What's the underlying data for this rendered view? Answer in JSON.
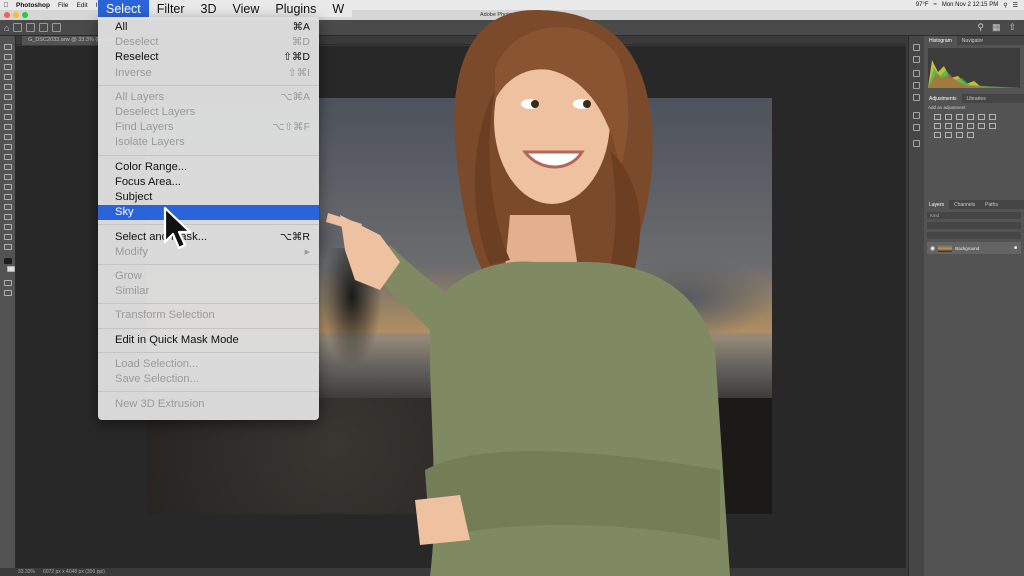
{
  "mac_menubar": {
    "app_name": "Photoshop",
    "items": [
      "File",
      "Edit",
      "Im"
    ],
    "big_items": [
      "Select",
      "Filter",
      "3D",
      "View",
      "Plugins",
      "W"
    ],
    "right_status": "97°F",
    "clock": "Mon Nov 2  12:15 PM"
  },
  "window": {
    "title": "Adobe Photoshop 2021"
  },
  "document": {
    "tab_label": "G_DSC2033.arw @ 33.3% (RGB/"
  },
  "status": {
    "zoom": "33.33%",
    "doc_info": "6072 px x 4048 px (300 ppi)"
  },
  "panels": {
    "top_tabs": [
      "Histogram",
      "Navigator"
    ],
    "adj_tabs": [
      "Adjustments",
      "Libraries"
    ],
    "adj_hint": "Add an adjustment",
    "layers_tabs": [
      "Layers",
      "Channels",
      "Paths"
    ],
    "layer_filter": "Kind",
    "layer_name": "Background"
  },
  "select_menu": {
    "title": "Select",
    "groups": [
      [
        {
          "label": "All",
          "shortcut": "⌘A",
          "disabled": false
        },
        {
          "label": "Deselect",
          "shortcut": "⌘D",
          "disabled": true
        },
        {
          "label": "Reselect",
          "shortcut": "⇧⌘D",
          "disabled": false
        },
        {
          "label": "Inverse",
          "shortcut": "⇧⌘I",
          "disabled": true
        }
      ],
      [
        {
          "label": "All Layers",
          "shortcut": "⌥⌘A",
          "disabled": true
        },
        {
          "label": "Deselect Layers",
          "shortcut": "",
          "disabled": true
        },
        {
          "label": "Find Layers",
          "shortcut": "⌥⇧⌘F",
          "disabled": true
        },
        {
          "label": "Isolate Layers",
          "shortcut": "",
          "disabled": true
        }
      ],
      [
        {
          "label": "Color Range...",
          "shortcut": "",
          "disabled": false
        },
        {
          "label": "Focus Area...",
          "shortcut": "",
          "disabled": false
        },
        {
          "label": "Subject",
          "shortcut": "",
          "disabled": false
        },
        {
          "label": "Sky",
          "shortcut": "",
          "disabled": false,
          "highlighted": true
        }
      ],
      [
        {
          "label": "Select and Mask...",
          "shortcut": "⌥⌘R",
          "disabled": false
        },
        {
          "label": "Modify",
          "shortcut": "▶",
          "disabled": true
        }
      ],
      [
        {
          "label": "Grow",
          "shortcut": "",
          "disabled": true
        },
        {
          "label": "Similar",
          "shortcut": "",
          "disabled": true
        }
      ],
      [
        {
          "label": "Transform Selection",
          "shortcut": "",
          "disabled": true
        }
      ],
      [
        {
          "label": "Edit in Quick Mask Mode",
          "shortcut": "",
          "disabled": false
        }
      ],
      [
        {
          "label": "Load Selection...",
          "shortcut": "",
          "disabled": true
        },
        {
          "label": "Save Selection...",
          "shortcut": "",
          "disabled": true
        }
      ],
      [
        {
          "label": "New 3D Extrusion",
          "shortcut": "",
          "disabled": true
        }
      ]
    ]
  },
  "colors": {
    "menu_highlight": "#2b64d8",
    "ps_dark": "#535353",
    "canvas_bg": "#282828",
    "shirt": "#7f8a62"
  },
  "icons": [
    "apple-icon",
    "home-icon",
    "search-icon",
    "workspace-icon",
    "mouse-pointer-icon",
    "layer-visibility-eye-icon",
    "lock-icon"
  ]
}
